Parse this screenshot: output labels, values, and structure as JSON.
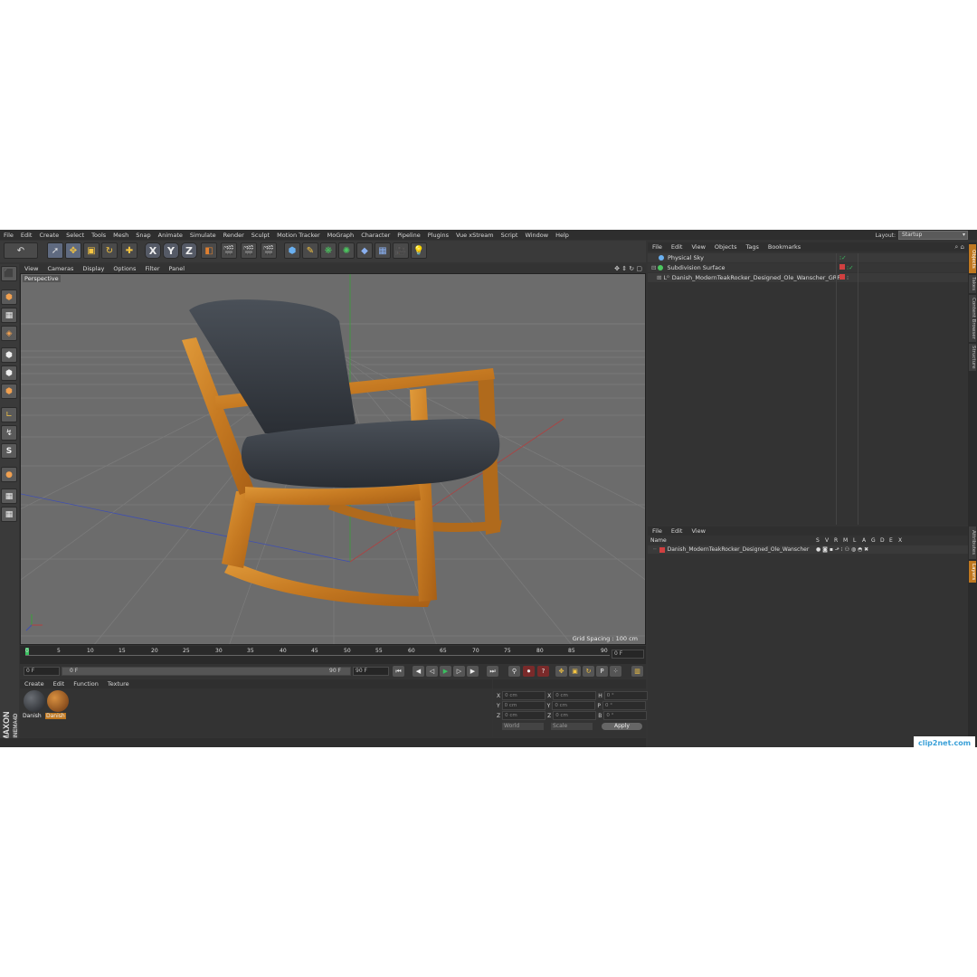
{
  "menubar": {
    "items": [
      "File",
      "Edit",
      "Create",
      "Select",
      "Tools",
      "Mesh",
      "Snap",
      "Animate",
      "Simulate",
      "Render",
      "Sculpt",
      "Motion Tracker",
      "MoGraph",
      "Character",
      "Pipeline",
      "Plugins",
      "Vue xStream",
      "Script",
      "Window",
      "Help"
    ],
    "layout_label": "Layout:",
    "layout_value": "Startup"
  },
  "toolbar": {
    "x_label": "X",
    "y_label": "Y",
    "z_label": "Z"
  },
  "viewport": {
    "menu": [
      "View",
      "Cameras",
      "Display",
      "Options",
      "Filter",
      "Panel"
    ],
    "label": "Perspective",
    "grid_spacing": "Grid Spacing : 100 cm"
  },
  "timeline": {
    "ticks": [
      "0",
      "5",
      "10",
      "15",
      "20",
      "25",
      "30",
      "35",
      "40",
      "45",
      "50",
      "55",
      "60",
      "65",
      "70",
      "75",
      "80",
      "85",
      "90"
    ],
    "current_frame": "0 F"
  },
  "playback": {
    "start_field": "0 F",
    "slider_start": "0 F",
    "slider_end": "90 F",
    "end_field": "90 F"
  },
  "material_manager": {
    "menu": [
      "Create",
      "Edit",
      "Function",
      "Texture"
    ],
    "materials": [
      {
        "label": "Danish",
        "color": "#2a2a2a"
      },
      {
        "label": "Danish",
        "color": "#8a4a1a"
      }
    ]
  },
  "coordinates": {
    "rows": [
      {
        "a": "X",
        "av": "0 cm",
        "b": "X",
        "bv": "0 cm",
        "c": "H",
        "cv": "0 °"
      },
      {
        "a": "Y",
        "av": "0 cm",
        "b": "Y",
        "bv": "0 cm",
        "c": "P",
        "cv": "0 °"
      },
      {
        "a": "Z",
        "av": "0 cm",
        "b": "Z",
        "bv": "0 cm",
        "c": "B",
        "cv": "0 °"
      }
    ],
    "mode1": "World",
    "mode2": "Scale",
    "apply_label": "Apply"
  },
  "object_manager": {
    "menu": [
      "File",
      "Edit",
      "View",
      "Objects",
      "Tags",
      "Bookmarks"
    ],
    "objects": [
      {
        "name": "Physical Sky"
      },
      {
        "name": "Subdivision Surface"
      },
      {
        "name": "Danish_ModernTeakRocker_Designed_Ole_Wanscher_GRP"
      }
    ]
  },
  "attribute_manager": {
    "menu": [
      "File",
      "Edit",
      "View"
    ],
    "name_header": "Name",
    "flag_headers": [
      "S",
      "V",
      "R",
      "M",
      "L",
      "A",
      "G",
      "D",
      "E",
      "X"
    ],
    "row_name": "Danish_ModernTeakRocker_Designed_Ole_Wanscher"
  },
  "side_tabs": [
    "Objects",
    "Takes",
    "Content Browser",
    "Structure",
    "Attributes",
    "Layers"
  ],
  "brand": {
    "line1": "MAXON",
    "line2": "CINEMA4D"
  },
  "watermark": "clip2net.com",
  "colors": {
    "accent": "#c07820",
    "viewport_bg": "#6c6c6c",
    "panel_bg": "#333333"
  }
}
